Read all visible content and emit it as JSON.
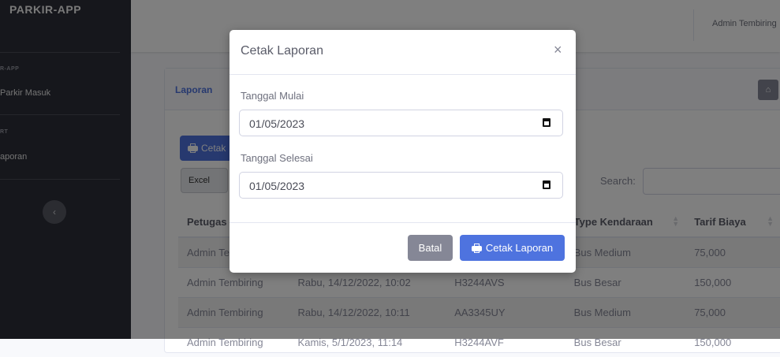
{
  "app": {
    "brand": "PARKIR-APP"
  },
  "sidebar": {
    "sections": [
      {
        "heading": "R-APP",
        "items": [
          {
            "label": "Parkir Masuk"
          }
        ]
      },
      {
        "heading": "RT",
        "items": [
          {
            "label": "aporan"
          }
        ]
      }
    ],
    "toggle_icon": "chevron-left-icon"
  },
  "topbar": {
    "user_name": "Admin Tembiring"
  },
  "card": {
    "title": "Laporan",
    "home_icon": "home-icon",
    "cetak_button_label": "Cetak",
    "excel_button_label": "Excel",
    "search_label": "Search:"
  },
  "table": {
    "columns": [
      "Petugas",
      "",
      "",
      "Type Kendaraan",
      "Tarif Biaya"
    ],
    "rows": [
      [
        "Admin Tembiring",
        "",
        "",
        "Bus Medium",
        "75,000"
      ],
      [
        "Admin Tembiring",
        "Rabu, 14/12/2022, 10:02",
        "H3244AVS",
        "Bus Besar",
        "150,000"
      ],
      [
        "Admin Tembiring",
        "Rabu, 14/12/2022, 10:11",
        "AA3345UY",
        "Bus Medium",
        "75,000"
      ],
      [
        "Admin Tembiring",
        "Kamis, 5/1/2023, 11:14",
        "H3244AVF",
        "Bus Besar",
        "150,000"
      ]
    ]
  },
  "modal": {
    "title": "Cetak Laporan",
    "close_glyph": "×",
    "start_label": "Tanggal Mulai",
    "start_value": "01/05/2023",
    "end_label": "Tanggal Selesai",
    "end_value": "01/05/2023",
    "cancel_label": "Batal",
    "print_label": "Cetak Laporan"
  },
  "colors": {
    "primary": "#4e73df",
    "secondary": "#858796",
    "sidebar": "#2c2e38"
  }
}
